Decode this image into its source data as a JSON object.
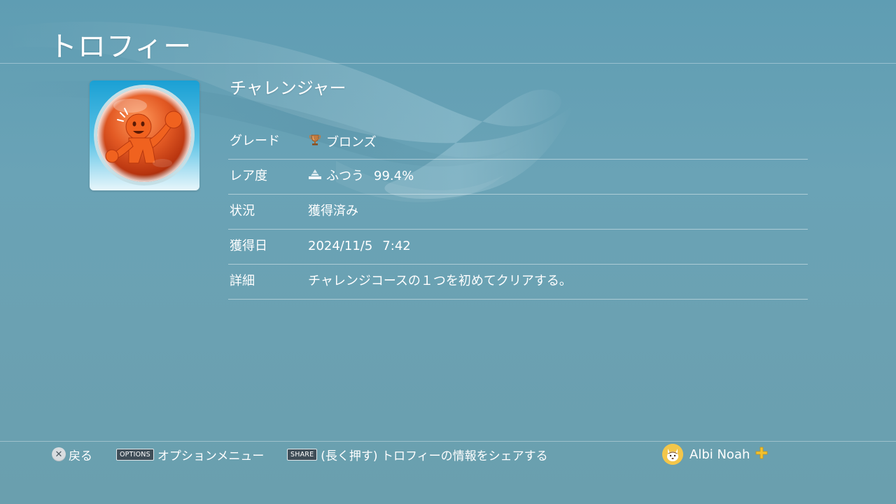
{
  "page": {
    "title": "トロフィー"
  },
  "trophy": {
    "name": "チャレンジャー",
    "image_icon": "trophy-art-icon",
    "rows": [
      {
        "key": "grade",
        "label": "グレード",
        "value": "ブロンズ",
        "icon": "bronze-trophy-icon"
      },
      {
        "key": "rarity",
        "label": "レア度",
        "value": "ふつう",
        "extra": "99.4%",
        "icon": "rarity-pyramid-icon"
      },
      {
        "key": "status",
        "label": "状況",
        "value": "獲得済み"
      },
      {
        "key": "earned_date",
        "label": "獲得日",
        "value": "2024/11/5",
        "extra": "7:42"
      },
      {
        "key": "details",
        "label": "詳細",
        "value": "チャレンジコースの１つを初めてクリアする。"
      }
    ]
  },
  "footer": {
    "back_label": "戻る",
    "options_key": "OPTIONS",
    "options_label": "オプションメニュー",
    "share_key": "SHARE",
    "share_label": "(長く押す) トロフィーの情報をシェアする",
    "user_name": "Albi Noah",
    "plus_icon": "ps-plus-icon"
  },
  "colors": {
    "background": "#6aa3b6",
    "bronze": "#b8763d",
    "image_bg": "#1aa0d4"
  }
}
